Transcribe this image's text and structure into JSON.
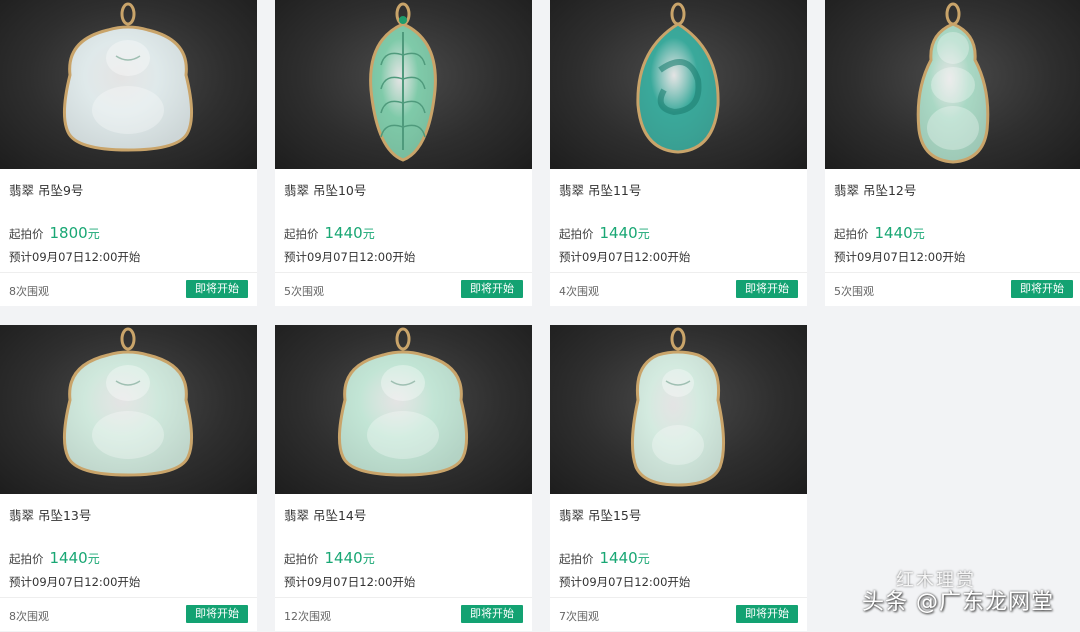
{
  "listings": [
    {
      "title": "翡翠 吊坠9号",
      "price_label": "起拍价",
      "price": "1800",
      "unit": "元",
      "schedule": "预计09月07日12:00开始",
      "views": "8次围观",
      "button": "即将开始",
      "jade_color": "#dfe9ea",
      "shape": "buddha"
    },
    {
      "title": "翡翠 吊坠10号",
      "price_label": "起拍价",
      "price": "1440",
      "unit": "元",
      "schedule": "预计09月07日12:00开始",
      "views": "5次围观",
      "button": "即将开始",
      "jade_color": "#7fcaa9",
      "shape": "leaf"
    },
    {
      "title": "翡翠 吊坠11号",
      "price_label": "起拍价",
      "price": "1440",
      "unit": "元",
      "schedule": "预计09月07日12:00开始",
      "views": "4次围观",
      "button": "即将开始",
      "jade_color": "#3aa99b",
      "shape": "drop"
    },
    {
      "title": "翡翠 吊坠12号",
      "price_label": "起拍价",
      "price": "1440",
      "unit": "元",
      "schedule": "预计09月07日12:00开始",
      "views": "5次围观",
      "button": "即将开始",
      "jade_color": "#a9d8c4",
      "shape": "gourd"
    },
    {
      "title": "翡翠 吊坠13号",
      "price_label": "起拍价",
      "price": "1440",
      "unit": "元",
      "schedule": "预计09月07日12:00开始",
      "views": "8次围观",
      "button": "即将开始",
      "jade_color": "#cfe8dc",
      "shape": "buddha"
    },
    {
      "title": "翡翠 吊坠14号",
      "price_label": "起拍价",
      "price": "1440",
      "unit": "元",
      "schedule": "预计09月07日12:00开始",
      "views": "12次围观",
      "button": "即将开始",
      "jade_color": "#c2e5d5",
      "shape": "buddha"
    },
    {
      "title": "翡翠 吊坠15号",
      "price_label": "起拍价",
      "price": "1440",
      "unit": "元",
      "schedule": "预计09月07日12:00开始",
      "views": "7次围观",
      "button": "即将开始",
      "jade_color": "#d3eadf",
      "shape": "buddha-tall"
    }
  ],
  "watermark": {
    "line1": "红木理赏",
    "line2": "头条 @广东龙网堂"
  },
  "colors": {
    "accent": "#13a272",
    "price": "#19a774",
    "page_bg": "#f2f3f5",
    "frame_gold": "#c9a46a"
  }
}
